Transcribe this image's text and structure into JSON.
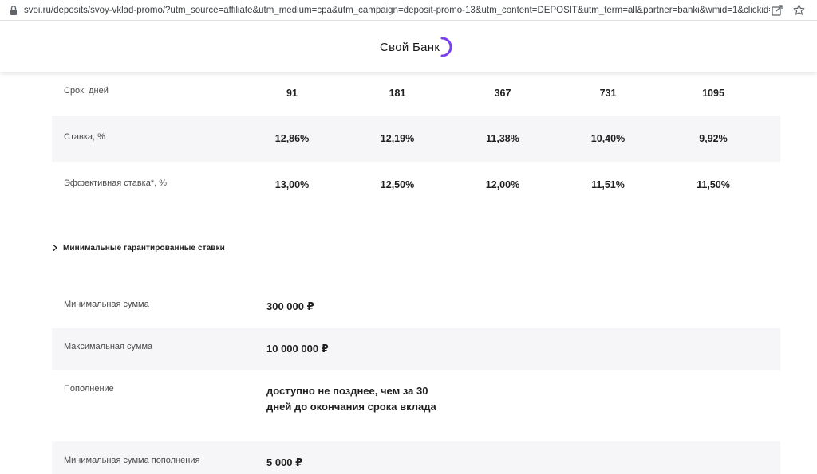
{
  "browser": {
    "url": "svoi.ru/deposits/svoy-vklad-promo/?utm_source=affiliate&utm_medium=cpa&utm_campaign=deposit-promo-13&utm_content=DEPOSIT&utm_term=all&partner=banki&wmid=1&clickid=..."
  },
  "header": {
    "logo_text": "Свой Банк",
    "accent_color": "#7b3ff2"
  },
  "rates_table": {
    "term_label": "Срок, дней",
    "terms": [
      "91",
      "181",
      "367",
      "731",
      "1095"
    ],
    "rate_label": "Ставка, %",
    "rates": [
      "12,86%",
      "12,19%",
      "11,38%",
      "10,40%",
      "9,92%"
    ],
    "effective_label": "Эффективная ставка*, %",
    "effective_rates": [
      "13,00%",
      "12,50%",
      "12,00%",
      "11,51%",
      "11,50%"
    ]
  },
  "guaranteed": {
    "label": "Минимальные гарантированные ставки"
  },
  "properties": [
    {
      "label": "Минимальная сумма",
      "value": "300 000 ₽"
    },
    {
      "label": "Максимальная сумма",
      "value": "10 000 000 ₽"
    },
    {
      "label": "Пополнение",
      "value": "доступно не позднее, чем за 30 дней до окончания срока вклада"
    },
    {
      "label": "Минимальная сумма пополнения",
      "value": "5 000 ₽"
    }
  ]
}
